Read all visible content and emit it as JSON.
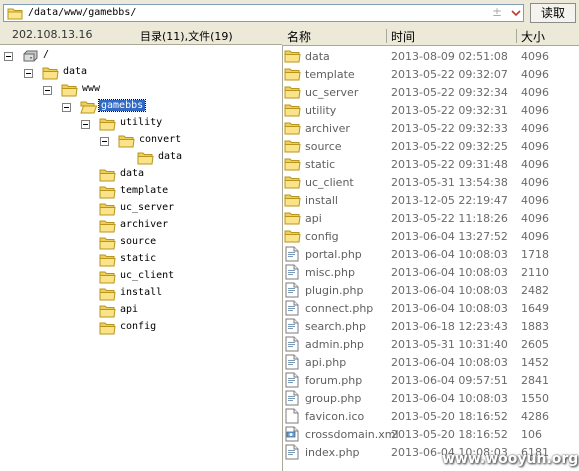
{
  "address": {
    "path": "/data/www/gamebbs/",
    "plus": "±",
    "read_label": "读取"
  },
  "status": {
    "ip": "202.108.13.16",
    "counts": "目录(11),文件(19)"
  },
  "tree": [
    {
      "label": "/",
      "icon": "drive"
    },
    {
      "label": "data",
      "icon": "folder"
    },
    {
      "label": "www",
      "icon": "folder"
    },
    {
      "label": "gamebbs",
      "icon": "folder",
      "selected": true
    },
    {
      "label": "utility",
      "icon": "folder"
    },
    {
      "label": "convert",
      "icon": "folder"
    },
    {
      "label": "data",
      "icon": "folder"
    },
    {
      "label": "data",
      "icon": "folder"
    },
    {
      "label": "template",
      "icon": "folder"
    },
    {
      "label": "uc_server",
      "icon": "folder"
    },
    {
      "label": "archiver",
      "icon": "folder"
    },
    {
      "label": "source",
      "icon": "folder"
    },
    {
      "label": "static",
      "icon": "folder"
    },
    {
      "label": "uc_client",
      "icon": "folder"
    },
    {
      "label": "install",
      "icon": "folder"
    },
    {
      "label": "api",
      "icon": "folder"
    },
    {
      "label": "config",
      "icon": "folder"
    }
  ],
  "list": {
    "headers": {
      "name": "名称",
      "time": "时间",
      "size": "大小"
    },
    "rows": [
      {
        "icon": "folder",
        "name": "data",
        "time": "2013-08-09 02:51:08",
        "size": "4096"
      },
      {
        "icon": "folder",
        "name": "template",
        "time": "2013-05-22 09:32:07",
        "size": "4096"
      },
      {
        "icon": "folder",
        "name": "uc_server",
        "time": "2013-05-22 09:32:34",
        "size": "4096"
      },
      {
        "icon": "folder",
        "name": "utility",
        "time": "2013-05-22 09:32:31",
        "size": "4096"
      },
      {
        "icon": "folder",
        "name": "archiver",
        "time": "2013-05-22 09:32:33",
        "size": "4096"
      },
      {
        "icon": "folder",
        "name": "source",
        "time": "2013-05-22 09:32:25",
        "size": "4096"
      },
      {
        "icon": "folder",
        "name": "static",
        "time": "2013-05-22 09:31:48",
        "size": "4096"
      },
      {
        "icon": "folder",
        "name": "uc_client",
        "time": "2013-05-31 13:54:38",
        "size": "4096"
      },
      {
        "icon": "folder",
        "name": "install",
        "time": "2013-12-05 22:19:47",
        "size": "4096"
      },
      {
        "icon": "folder",
        "name": "api",
        "time": "2013-05-22 11:18:26",
        "size": "4096"
      },
      {
        "icon": "folder",
        "name": "config",
        "time": "2013-06-04 13:27:52",
        "size": "4096"
      },
      {
        "icon": "php",
        "name": "portal.php",
        "time": "2013-06-04 10:08:03",
        "size": "1718"
      },
      {
        "icon": "php",
        "name": "misc.php",
        "time": "2013-06-04 10:08:03",
        "size": "2110"
      },
      {
        "icon": "php",
        "name": "plugin.php",
        "time": "2013-06-04 10:08:03",
        "size": "2482"
      },
      {
        "icon": "php",
        "name": "connect.php",
        "time": "2013-06-04 10:08:03",
        "size": "1649"
      },
      {
        "icon": "php",
        "name": "search.php",
        "time": "2013-06-18 12:23:43",
        "size": "1883"
      },
      {
        "icon": "php",
        "name": "admin.php",
        "time": "2013-05-31 10:31:40",
        "size": "2605"
      },
      {
        "icon": "php",
        "name": "api.php",
        "time": "2013-06-04 10:08:03",
        "size": "1452"
      },
      {
        "icon": "php",
        "name": "forum.php",
        "time": "2013-06-04 09:57:51",
        "size": "2841"
      },
      {
        "icon": "php",
        "name": "group.php",
        "time": "2013-06-04 10:08:03",
        "size": "1550"
      },
      {
        "icon": "ico",
        "name": "favicon.ico",
        "time": "2013-05-20 18:16:52",
        "size": "4286"
      },
      {
        "icon": "xml",
        "name": "crossdomain.xml",
        "time": "2013-05-20 18:16:52",
        "size": "106"
      },
      {
        "icon": "php",
        "name": "index.php",
        "time": "2013-06-04 10:08:03",
        "size": "6181"
      }
    ]
  },
  "watermark": "www.wooyun.org"
}
